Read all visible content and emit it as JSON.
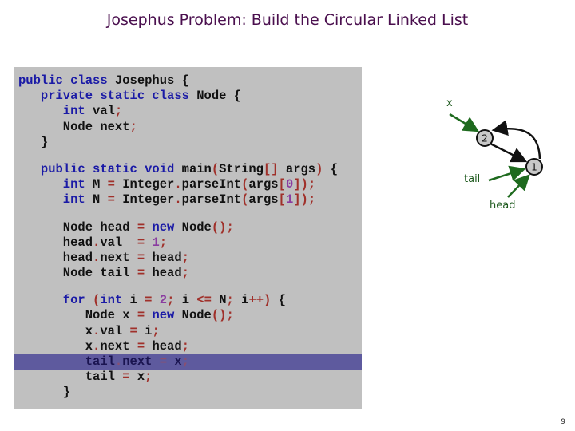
{
  "slide": {
    "title": "Josephus Problem:  Build the Circular Linked List",
    "page_number": "9"
  },
  "code": {
    "highlighted_line": "tail.next = x;",
    "lines": [
      [
        {
          "t": "public class ",
          "c": "kw"
        },
        {
          "t": "Josephus {",
          "c": "plain"
        }
      ],
      [
        {
          "t": "   private static class ",
          "c": "kw"
        },
        {
          "t": "Node {",
          "c": "plain"
        }
      ],
      [
        {
          "t": "      int ",
          "c": "kw"
        },
        {
          "t": "val",
          "c": "plain"
        },
        {
          "t": ";",
          "c": "op"
        }
      ],
      [
        {
          "t": "      Node next",
          "c": "plain"
        },
        {
          "t": ";",
          "c": "op"
        }
      ],
      [
        {
          "t": "   }",
          "c": "plain"
        }
      ],
      [],
      [
        {
          "t": "   public static void ",
          "c": "kw"
        },
        {
          "t": "main",
          "c": "plain"
        },
        {
          "t": "(",
          "c": "op"
        },
        {
          "t": "String",
          "c": "plain"
        },
        {
          "t": "[]",
          "c": "op"
        },
        {
          "t": " args",
          "c": "plain"
        },
        {
          "t": ")",
          "c": "op"
        },
        {
          "t": " {",
          "c": "plain"
        }
      ],
      [
        {
          "t": "      int ",
          "c": "kw"
        },
        {
          "t": "M ",
          "c": "plain"
        },
        {
          "t": "=",
          "c": "op"
        },
        {
          "t": " Integer",
          "c": "plain"
        },
        {
          "t": ".",
          "c": "op"
        },
        {
          "t": "parseInt",
          "c": "plain"
        },
        {
          "t": "(",
          "c": "op"
        },
        {
          "t": "args",
          "c": "plain"
        },
        {
          "t": "[",
          "c": "op"
        },
        {
          "t": "0",
          "c": "num"
        },
        {
          "t": "])",
          "c": "op"
        },
        {
          "t": ";",
          "c": "op"
        }
      ],
      [
        {
          "t": "      int ",
          "c": "kw"
        },
        {
          "t": "N ",
          "c": "plain"
        },
        {
          "t": "=",
          "c": "op"
        },
        {
          "t": " Integer",
          "c": "plain"
        },
        {
          "t": ".",
          "c": "op"
        },
        {
          "t": "parseInt",
          "c": "plain"
        },
        {
          "t": "(",
          "c": "op"
        },
        {
          "t": "args",
          "c": "plain"
        },
        {
          "t": "[",
          "c": "op"
        },
        {
          "t": "1",
          "c": "num"
        },
        {
          "t": "])",
          "c": "op"
        },
        {
          "t": ";",
          "c": "op"
        }
      ],
      [],
      [
        {
          "t": "      Node head ",
          "c": "plain"
        },
        {
          "t": "=",
          "c": "op"
        },
        {
          "t": " new ",
          "c": "kw"
        },
        {
          "t": "Node",
          "c": "plain"
        },
        {
          "t": "()",
          "c": "op"
        },
        {
          "t": ";",
          "c": "op"
        }
      ],
      [
        {
          "t": "      head",
          "c": "plain"
        },
        {
          "t": ".",
          "c": "op"
        },
        {
          "t": "val  ",
          "c": "plain"
        },
        {
          "t": "=",
          "c": "op"
        },
        {
          "t": " 1",
          "c": "num"
        },
        {
          "t": ";",
          "c": "op"
        }
      ],
      [
        {
          "t": "      head",
          "c": "plain"
        },
        {
          "t": ".",
          "c": "op"
        },
        {
          "t": "next ",
          "c": "plain"
        },
        {
          "t": "=",
          "c": "op"
        },
        {
          "t": " head",
          "c": "plain"
        },
        {
          "t": ";",
          "c": "op"
        }
      ],
      [
        {
          "t": "      Node tail ",
          "c": "plain"
        },
        {
          "t": "=",
          "c": "op"
        },
        {
          "t": " head",
          "c": "plain"
        },
        {
          "t": ";",
          "c": "op"
        }
      ],
      [],
      [
        {
          "t": "      for ",
          "c": "kw"
        },
        {
          "t": "(",
          "c": "op"
        },
        {
          "t": "int ",
          "c": "kw"
        },
        {
          "t": "i ",
          "c": "plain"
        },
        {
          "t": "=",
          "c": "op"
        },
        {
          "t": " 2",
          "c": "num"
        },
        {
          "t": ";",
          "c": "op"
        },
        {
          "t": " i ",
          "c": "plain"
        },
        {
          "t": "<=",
          "c": "op"
        },
        {
          "t": " N",
          "c": "plain"
        },
        {
          "t": ";",
          "c": "op"
        },
        {
          "t": " i",
          "c": "plain"
        },
        {
          "t": "++)",
          "c": "op"
        },
        {
          "t": " {",
          "c": "plain"
        }
      ],
      [
        {
          "t": "         Node x ",
          "c": "plain"
        },
        {
          "t": "=",
          "c": "op"
        },
        {
          "t": " new ",
          "c": "kw"
        },
        {
          "t": "Node",
          "c": "plain"
        },
        {
          "t": "()",
          "c": "op"
        },
        {
          "t": ";",
          "c": "op"
        }
      ],
      [
        {
          "t": "         x",
          "c": "plain"
        },
        {
          "t": ".",
          "c": "op"
        },
        {
          "t": "val ",
          "c": "plain"
        },
        {
          "t": "=",
          "c": "op"
        },
        {
          "t": " i",
          "c": "plain"
        },
        {
          "t": ";",
          "c": "op"
        }
      ],
      [
        {
          "t": "         x",
          "c": "plain"
        },
        {
          "t": ".",
          "c": "op"
        },
        {
          "t": "next ",
          "c": "plain"
        },
        {
          "t": "=",
          "c": "op"
        },
        {
          "t": " head",
          "c": "plain"
        },
        {
          "t": ";",
          "c": "op"
        }
      ],
      [
        {
          "t": "         tail",
          "c": "plain"
        },
        {
          "t": ".",
          "c": "op"
        },
        {
          "t": "next ",
          "c": "plain"
        },
        {
          "t": "=",
          "c": "op"
        },
        {
          "t": " x",
          "c": "plain"
        },
        {
          "t": ";",
          "c": "op"
        }
      ],
      [
        {
          "t": "         tail ",
          "c": "plain"
        },
        {
          "t": "=",
          "c": "op"
        },
        {
          "t": " x",
          "c": "plain"
        },
        {
          "t": ";",
          "c": "op"
        }
      ],
      [
        {
          "t": "      }",
          "c": "plain"
        }
      ]
    ],
    "highlight_index": 19,
    "colors": {
      "panel_bg": "#c0c0c0",
      "highlight_bg": "#5e5a9e",
      "keyword": "#1a1aa6",
      "operator": "#a0302a",
      "number": "#8a3ca0"
    }
  },
  "diagram": {
    "nodes": [
      {
        "id": "node-2",
        "label": "2"
      },
      {
        "id": "node-1",
        "label": "1"
      }
    ],
    "pointers": [
      {
        "name": "x",
        "label": "x",
        "target": "2"
      },
      {
        "name": "tail",
        "label": "tail",
        "target": "1"
      },
      {
        "name": "head",
        "label": "head",
        "target": "1"
      }
    ],
    "links": [
      {
        "from": "2",
        "to": "1"
      },
      {
        "from": "1",
        "to": "2"
      }
    ],
    "colors": {
      "pointer": "#1e6a1e",
      "node_fill": "#c8c8c8",
      "link": "#111111"
    }
  }
}
